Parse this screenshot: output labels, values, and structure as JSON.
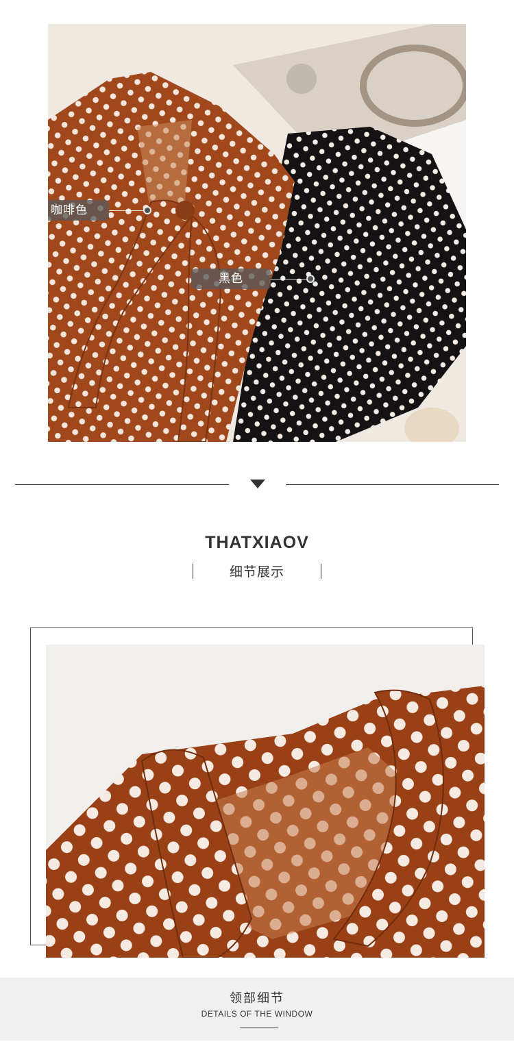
{
  "top_photo": {
    "tags": [
      {
        "label": "咖啡色"
      },
      {
        "label": "黑色"
      }
    ],
    "colors": {
      "brown": "#a0471b",
      "black": "#141212",
      "dot": "#f3e6dc",
      "backdrop": "#efe9e2"
    }
  },
  "heading": {
    "brand": "THATXIAOV",
    "subtitle": "细节展示"
  },
  "detail": {
    "caption_cn": "领部细节",
    "caption_en": "DETAILS OF THE WINDOW"
  }
}
